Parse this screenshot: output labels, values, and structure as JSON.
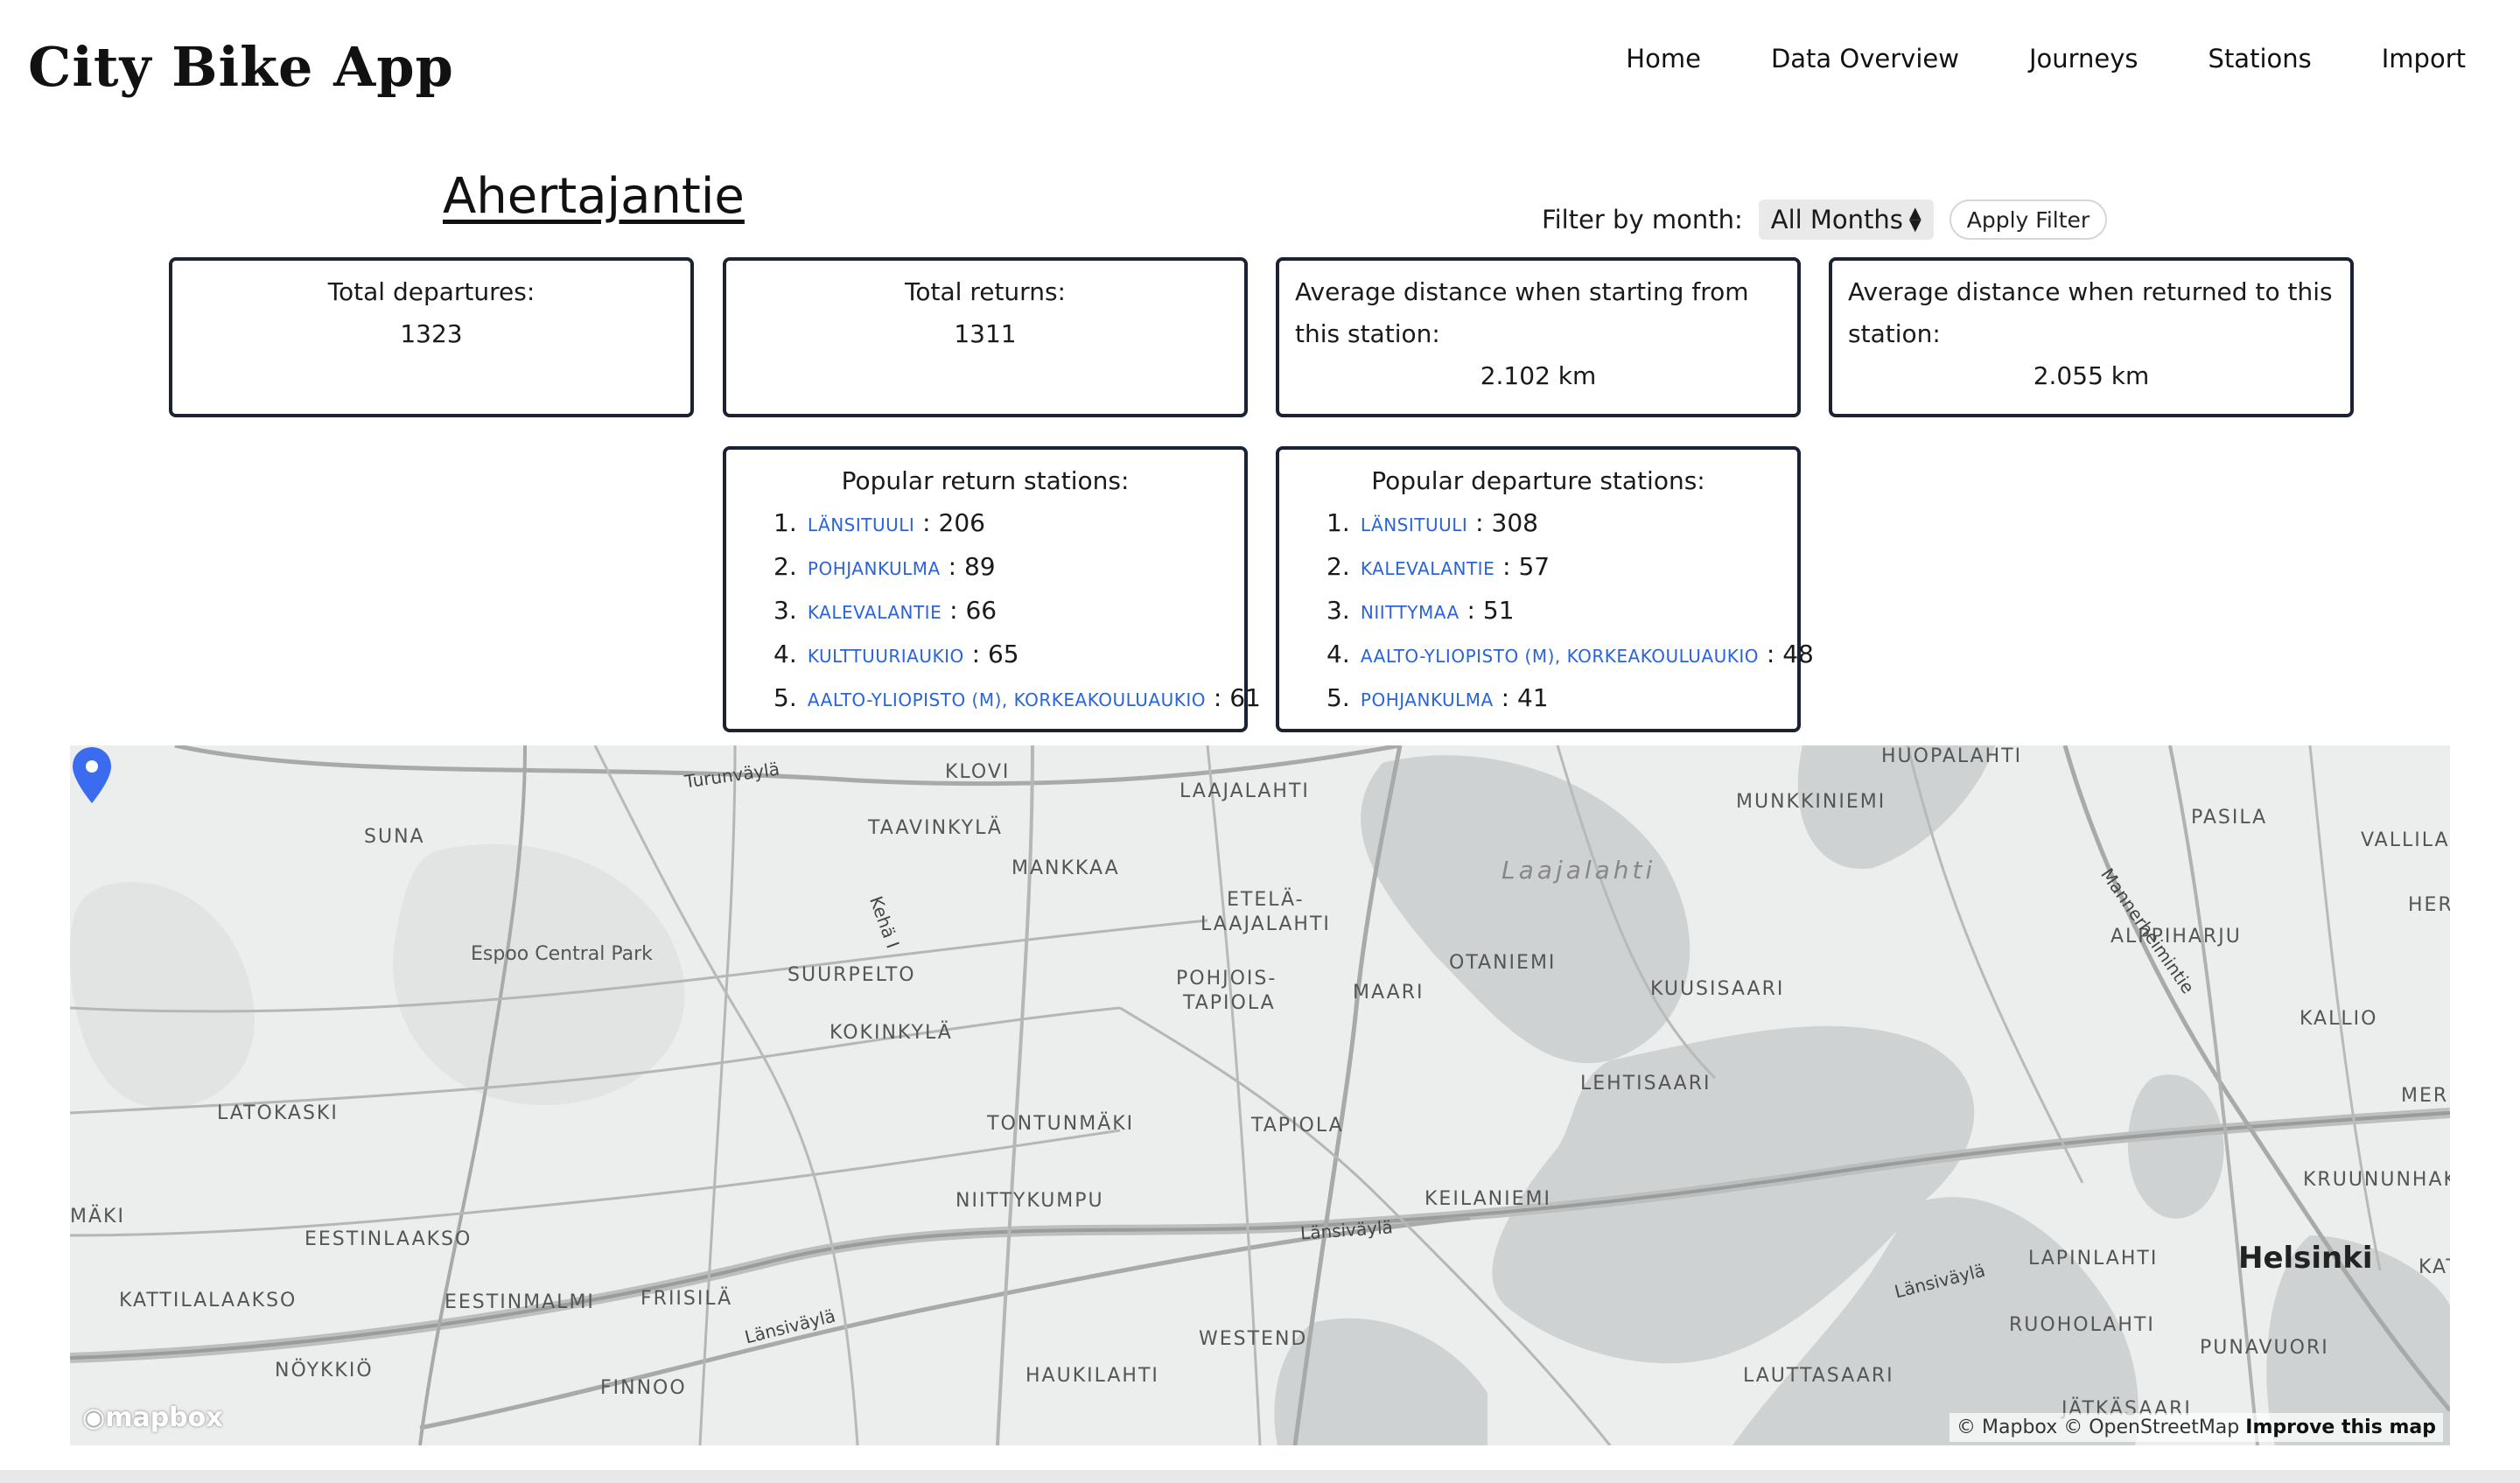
{
  "app": {
    "title": "City Bike App"
  },
  "nav": {
    "items": [
      {
        "label": "Home"
      },
      {
        "label": "Data Overview"
      },
      {
        "label": "Journeys"
      },
      {
        "label": "Stations"
      },
      {
        "label": "Import"
      }
    ]
  },
  "station": {
    "name": "Ahertajantie"
  },
  "filter": {
    "label": "Filter by month:",
    "selected": "All Months",
    "button": "Apply Filter"
  },
  "stats": {
    "departures": {
      "label": "Total departures:",
      "value": "1323"
    },
    "returns": {
      "label": "Total returns:",
      "value": "1311"
    },
    "avg_start": {
      "label": "Average distance when starting from this station:",
      "value": "2.102 km"
    },
    "avg_return": {
      "label": "Average distance when returned to this station:",
      "value": "2.055 km"
    }
  },
  "popular_return": {
    "title": "Popular return stations:",
    "items": [
      {
        "rank": "1.",
        "name": "Länsituuli",
        "count": "206"
      },
      {
        "rank": "2.",
        "name": "Pohjankulma",
        "count": "89"
      },
      {
        "rank": "3.",
        "name": "Kalevalantie",
        "count": "66"
      },
      {
        "rank": "4.",
        "name": "Kulttuuriaukio",
        "count": "65"
      },
      {
        "rank": "5.",
        "name": "Aalto-yliopisto (M), Korkeakouluaukio",
        "count": "61"
      }
    ]
  },
  "popular_departure": {
    "title": "Popular departure stations:",
    "items": [
      {
        "rank": "1.",
        "name": "Länsituuli",
        "count": "308"
      },
      {
        "rank": "2.",
        "name": "Kalevalantie",
        "count": "57"
      },
      {
        "rank": "3.",
        "name": "Niittymaa",
        "count": "51"
      },
      {
        "rank": "4.",
        "name": "Aalto-yliopisto (M), Korkeakouluaukio",
        "count": "48"
      },
      {
        "rank": "5.",
        "name": "Pohjankulma",
        "count": "41"
      }
    ]
  },
  "map": {
    "labels": {
      "klovi": "KLOVI",
      "laajalahti_area": "LAAJALAHTI",
      "huopalahti": "HUOPALAHTI",
      "suna": "SUNA",
      "taavinkyla": "TAAVINKYLÄ",
      "munkkiniemi": "MUNKKINIEMI",
      "pasila": "PASILA",
      "vallila": "VALLILA",
      "mankkaa": "MANKKAA",
      "laajalahti_water": "Laajalahti",
      "etela_laajalahti_1": "ETELÄ-",
      "etela_laajalahti_2": "LAAJALAHTI",
      "herni": "HERN",
      "espoo_central_park": "Espoo Central Park",
      "alppiharju": "ALPPIHARJU",
      "suurpelto": "SUURPELTO",
      "pohjois_tapiola_1": "POHJOIS-",
      "pohjois_tapiola_2": "TAPIOLA",
      "otaniemi": "OTANIEMI",
      "maari": "MAARI",
      "kuusisaari": "KUUSISAARI",
      "kallio": "KALLIO",
      "kokinkyla": "KOKINKYLÄ",
      "merih": "MERIH",
      "latokaski": "LATOKASKI",
      "tontunmaki": "TONTUNMÄKI",
      "tapiola": "TAPIOLA",
      "lehtisaari": "LEHTISAARI",
      "kruununhaka": "KRUUNUNHAK",
      "niittykumpu": "NIITTYKUMPU",
      "keilaniemi": "KEILANIEMI",
      "maki": "MÄKI",
      "eestinlaakso": "EESTINLAAKSO",
      "helsinki": "Helsinki",
      "lapinlahti": "LAPINLAHTI",
      "kattilalaakso": "KATTILALAAKSO",
      "eestinmalmi": "EESTINMALMI",
      "friisila": "FRIISILÄ",
      "kat": "KAT",
      "westend": "WESTEND",
      "ruoholahti": "RUOHOLAHTI",
      "punavuori": "PUNAVUORI",
      "noykkio": "NÖYKKIÖ",
      "haukilahti": "HAUKILAHTI",
      "lauttasaari": "LAUTTASAARI",
      "finnoo": "FINNOO",
      "jatkasaari": "JÄTKÄSAARI",
      "turunvayla": "Turunväylä",
      "kehalll": "Kehä I",
      "mannerheimintie": "Mannerheimintie",
      "lansivayla_1": "Länsiväylä",
      "lansivayla_2": "Länsiväylä",
      "lansivayla_3": "Länsiväylä"
    },
    "logo": "mapbox",
    "attribution": "© Mapbox © OpenStreetMap",
    "improve": "Improve this map",
    "pin_color": "#3b6cf0"
  }
}
